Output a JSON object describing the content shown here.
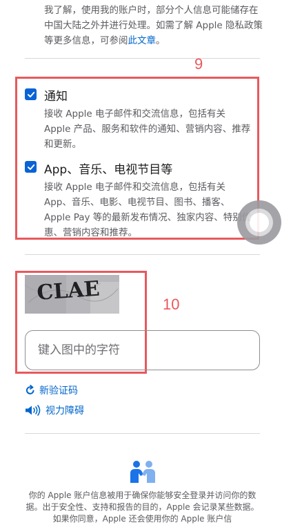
{
  "intro": {
    "text": "我了解，使用我的账户时，部分个人信息可能储存在中国大陆之外并进行处理。如需了解 Apple 隐私政策等更多信息，可参阅",
    "link": "此文章",
    "end": "。"
  },
  "annotations": {
    "box9": "9",
    "box10": "10"
  },
  "options": [
    {
      "title": "通知",
      "desc": "接收 Apple 电子邮件和交流信息，包括有关 Apple 产品、服务和软件的通知、营销内容、推荐和更新。",
      "checked": true
    },
    {
      "title": "App、音乐、电视节目等",
      "desc": "接收 Apple 电子邮件和交流信息，包括有关 App、音乐、电影、电视节目、图书、播客、Apple Pay 等的最新发布情况、独家内容、特别优惠、营销内容和推荐。",
      "checked": true
    }
  ],
  "captcha": {
    "text": "CLAE"
  },
  "captcha_input": {
    "placeholder": "键入图中的字符",
    "value": ""
  },
  "links": {
    "new_code": "新验证码",
    "vision": "视力障碍"
  },
  "footer": {
    "text": "你的 Apple 账户信息被用于确保你能够安全登录并访问你的数据。出于安全性、支持和报告的目的，Apple 会记录某些数据。如果你同意，Apple 还会使用你的 Apple 账户信"
  },
  "colors": {
    "accent": "#0066cc",
    "checkbox": "#0a63d6",
    "annotation": "#e8585c"
  }
}
